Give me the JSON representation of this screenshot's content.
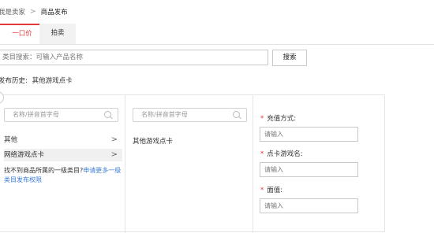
{
  "breadcrumb": {
    "first": "我是卖家",
    "second": "商品发布"
  },
  "tabs": {
    "fixed": "一口价",
    "auction": "拍卖"
  },
  "search": {
    "placeholder": "类目搜索：可输入产品名称",
    "button": "搜索"
  },
  "history": {
    "label": "发布历史:",
    "item": "其他游戏点卡"
  },
  "columns": {
    "filter_placeholder": "名称/拼音首字母",
    "level1": [
      {
        "label": "其他"
      },
      {
        "label": "网络游戏点卡"
      }
    ],
    "not_found": {
      "text": "找不到商品所属的一级类目?",
      "link": "申请更多一级类目发布权限"
    },
    "level2_item": "其他游戏点卡"
  },
  "form": {
    "required_mark": "*",
    "fields": [
      {
        "label": "充值方式:",
        "placeholder": "请输入"
      },
      {
        "label": "点卡游戏名:",
        "placeholder": "请输入"
      },
      {
        "label": "面值:",
        "placeholder": "请输入"
      }
    ]
  },
  "colors": {
    "accent": "#e4393c",
    "link": "#3b7ed6",
    "border": "#e4e4e4"
  },
  "icons": {
    "filter": "search-icon",
    "chevron": "chevron-right-icon"
  }
}
